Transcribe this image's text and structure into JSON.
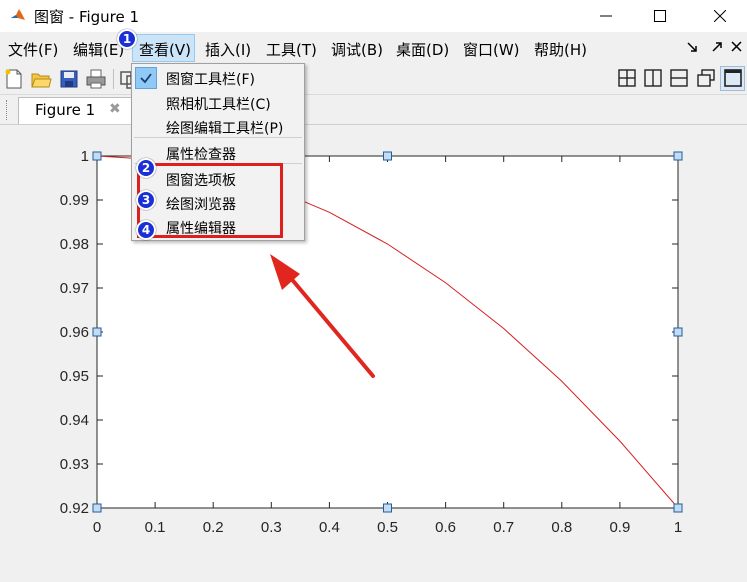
{
  "window": {
    "title": "图窗 - Figure 1",
    "icon": "matlab-logo-icon",
    "controls": [
      "minimize-icon",
      "maximize-icon",
      "close-icon"
    ]
  },
  "menubar": {
    "items": [
      "文件(F)",
      "编辑(E)",
      "查看(V)",
      "插入(I)",
      "工具(T)",
      "调试(B)",
      "桌面(D)",
      "窗口(W)",
      "帮助(H)"
    ],
    "open_menu": "查看(V)",
    "right_icons": [
      "dock-arrow-icon",
      "undock-icon",
      "close-icon"
    ]
  },
  "toolbar": {
    "icons": [
      "new-figure-icon",
      "open-file-icon",
      "save-icon",
      "print-icon",
      "link-icon"
    ],
    "layout_icons": [
      "grid-2x2-icon",
      "split-vertical-icon",
      "split-horizontal-icon",
      "float-window-icon",
      "single-window-icon"
    ]
  },
  "tabs": [
    {
      "label": "Figure 1",
      "close": "✖"
    }
  ],
  "view_menu": {
    "items": [
      {
        "label": "图窗工具栏(F)",
        "checked": true
      },
      {
        "label": "照相机工具栏(C)",
        "checked": false
      },
      {
        "label": "绘图编辑工具栏(P)",
        "checked": false
      },
      {
        "label": "属性检查器",
        "checked": false
      },
      {
        "label": "图窗选项板",
        "checked": false
      },
      {
        "label": "绘图浏览器",
        "checked": false
      },
      {
        "label": "属性编辑器",
        "checked": false
      }
    ]
  },
  "annotations": {
    "badges": [
      "1",
      "2",
      "3",
      "4"
    ],
    "highlight_color": "#dd1f1f",
    "badge_color": "#1a2fd6"
  },
  "chart_data": {
    "type": "line",
    "title": "",
    "xlabel": "",
    "ylabel": "",
    "xlim": [
      0,
      1
    ],
    "ylim": [
      0.92,
      1
    ],
    "xticks": [
      0,
      0.1,
      0.2,
      0.3,
      0.4,
      0.5,
      0.6,
      0.7,
      0.8,
      0.9,
      1
    ],
    "xtick_labels": [
      "0",
      "0.1",
      "0.2",
      "0.3",
      "0.4",
      "0.5",
      "0.6",
      "0.7",
      "0.8",
      "0.9",
      "1"
    ],
    "yticks": [
      0.92,
      0.93,
      0.94,
      0.95,
      0.96,
      0.97,
      0.98,
      0.99,
      1
    ],
    "ytick_labels": [
      "0.92",
      "0.93",
      "0.94",
      "0.95",
      "0.96",
      "0.97",
      "0.98",
      "0.99",
      "1"
    ],
    "series": [
      {
        "color": "#d62020",
        "x": [
          0,
          0.1,
          0.2,
          0.3,
          0.4,
          0.5,
          0.6,
          0.7,
          0.8,
          0.9,
          1
        ],
        "y": [
          1.0,
          0.9992,
          0.9968,
          0.9928,
          0.9872,
          0.98,
          0.9712,
          0.9608,
          0.9488,
          0.9352,
          0.92
        ]
      }
    ],
    "grid": false,
    "selected": true,
    "selection_handles": [
      [
        0,
        1
      ],
      [
        0.5,
        1
      ],
      [
        1,
        1
      ],
      [
        0,
        0.96
      ],
      [
        1,
        0.96
      ],
      [
        0,
        0.92
      ],
      [
        0.5,
        0.92
      ],
      [
        1,
        0.92
      ]
    ]
  }
}
